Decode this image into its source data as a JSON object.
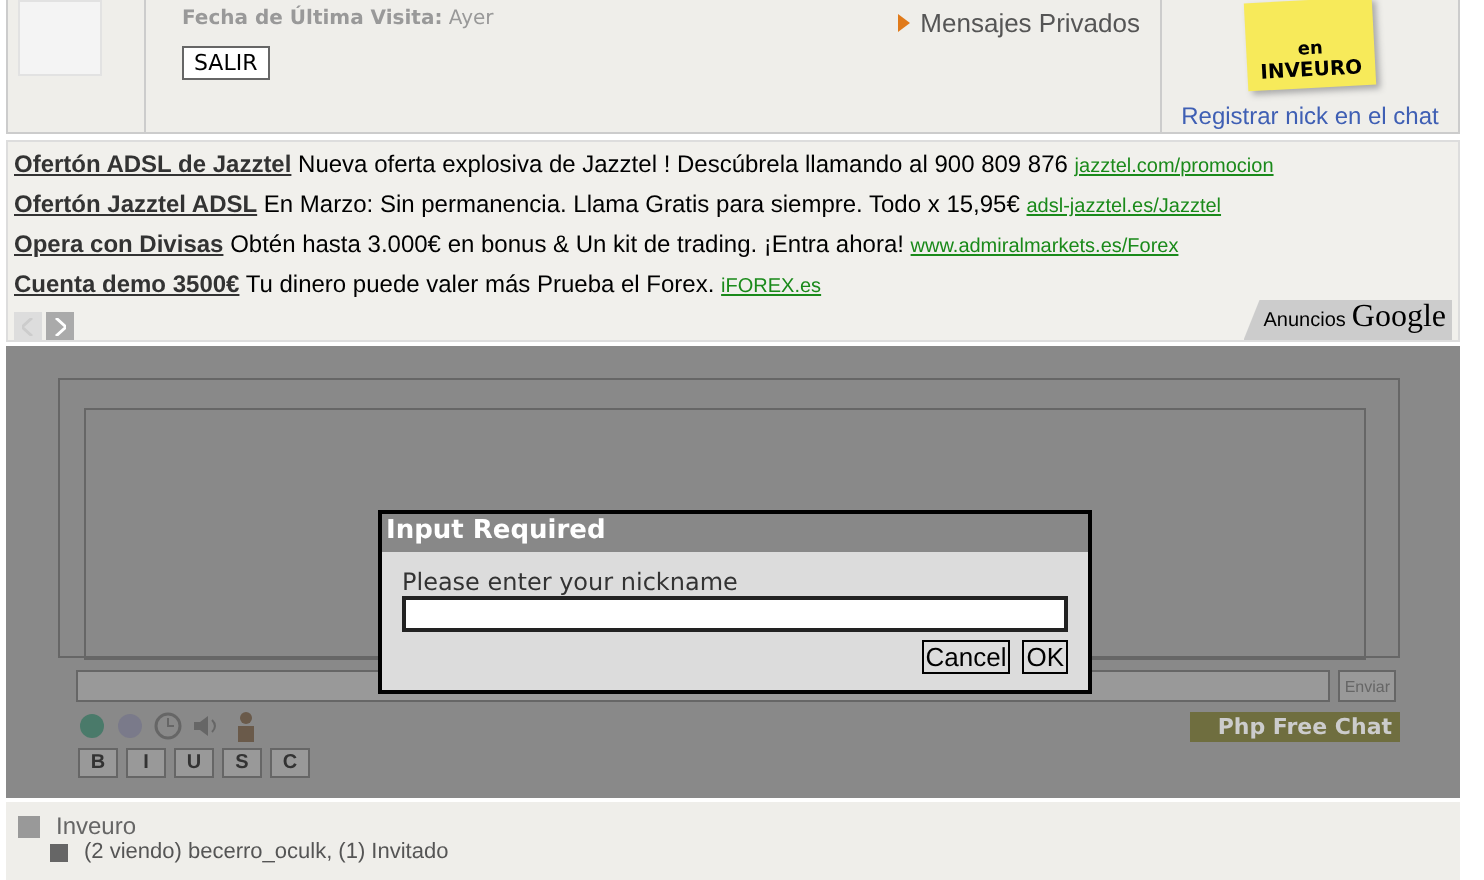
{
  "user_panel": {
    "last_visit_label": "Fecha de Última Visita:",
    "last_visit_value": "Ayer",
    "logout_button": "SALIR",
    "private_messages": "Mensajes Privados",
    "sticky_note": [
      "en",
      "INVEURO"
    ],
    "register_link": "Registrar nick en el chat"
  },
  "ads": [
    {
      "title": "Ofertón ADSL de Jazztel",
      "text": "Nueva oferta explosiva de Jazztel ! Descúbrela llamando al 900 809 876",
      "url": "jazztel.com/promocion"
    },
    {
      "title": "Ofertón Jazztel ADSL",
      "text": "En Marzo: Sin permanencia. Llama Gratis para siempre. Todo x 15,95€",
      "url": "adsl-jazztel.es/Jazztel"
    },
    {
      "title": "Opera con Divisas",
      "text": "Obtén hasta 3.000€ en bonus & Un kit de trading. ¡Entra ahora!",
      "url": "www.admiralmarkets.es/Forex"
    },
    {
      "title": "Cuenta demo 3500€",
      "text": "Tu dinero puede valer más Prueba el Forex.",
      "url": "iFOREX.es"
    }
  ],
  "ads_label": "Anuncios",
  "ads_brand": "Google",
  "chat": {
    "send_button": "Enviar",
    "logo": "Php Free Chat",
    "format_buttons": [
      "B",
      "I",
      "U",
      "S",
      "C"
    ]
  },
  "dialog": {
    "title": "Input Required",
    "prompt": "Please enter your nickname",
    "buttons": [
      "Cancel",
      "OK"
    ]
  },
  "forum": {
    "name": "Inveuro",
    "status": "(2 viendo) becerro_oculk, (1) Invitado"
  }
}
